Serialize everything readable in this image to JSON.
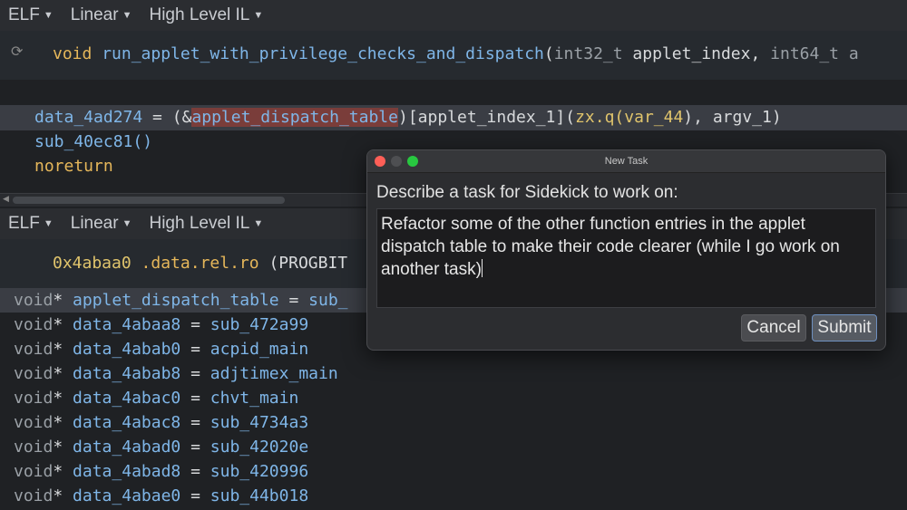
{
  "top_toolbar": {
    "view_type": "ELF",
    "mode": "Linear",
    "il": "High Level IL"
  },
  "top_pane": {
    "signature": {
      "ret": "void",
      "name": "run_applet_with_privilege_checks_and_dispatch",
      "paren": "(",
      "t1": "int32_t",
      "p1": "applet_index,",
      "t2": "int64_t a"
    },
    "line1": {
      "a": "data_4ad274",
      "b": " = (&",
      "c": "applet_dispatch_table",
      "d": ")[",
      "e": "applet_index_1",
      "f": "](",
      "g": "zx.q(",
      "h": "var_44",
      "i": "), ",
      "j": "argv_1",
      "k": ")"
    },
    "line2": "sub_40ec81()",
    "line3": "noreturn"
  },
  "bottom_toolbar": {
    "view_type": "ELF",
    "mode": "Linear",
    "il": "High Level IL"
  },
  "bottom_pane": {
    "segment": {
      "addr": "0x4abaa0",
      "name": ".data.rel.ro",
      "rest": "(PROGBIT"
    },
    "rows": [
      {
        "type": "void",
        "star": "*",
        "name": "applet_dispatch_table",
        "eq": " = ",
        "val": "sub_"
      },
      {
        "type": "void",
        "star": "*",
        "name": "data_4abaa8",
        "eq": " = ",
        "val": "sub_472a99"
      },
      {
        "type": "void",
        "star": "*",
        "name": "data_4abab0",
        "eq": " = ",
        "val": "acpid_main"
      },
      {
        "type": "void",
        "star": "*",
        "name": "data_4abab8",
        "eq": " = ",
        "val": "adjtimex_main"
      },
      {
        "type": "void",
        "star": "*",
        "name": "data_4abac0",
        "eq": " = ",
        "val": "chvt_main"
      },
      {
        "type": "void",
        "star": "*",
        "name": "data_4abac8",
        "eq": " = ",
        "val": "sub_4734a3"
      },
      {
        "type": "void",
        "star": "*",
        "name": "data_4abad0",
        "eq": " = ",
        "val": "sub_42020e"
      },
      {
        "type": "void",
        "star": "*",
        "name": "data_4abad8",
        "eq": " = ",
        "val": "sub_420996"
      },
      {
        "type": "void",
        "star": "*",
        "name": "data_4abae0",
        "eq": " = ",
        "val": "sub_44b018"
      }
    ]
  },
  "dialog": {
    "title": "New Task",
    "label": "Describe a task for Sidekick to work on:",
    "text": "Refactor some of the other function entries in the applet dispatch table to make their code clearer (while I go work on another task)",
    "cancel": "Cancel",
    "submit": "Submit"
  },
  "icons": {
    "refresh": "refresh-icon",
    "caret": "chevron-down-icon"
  }
}
